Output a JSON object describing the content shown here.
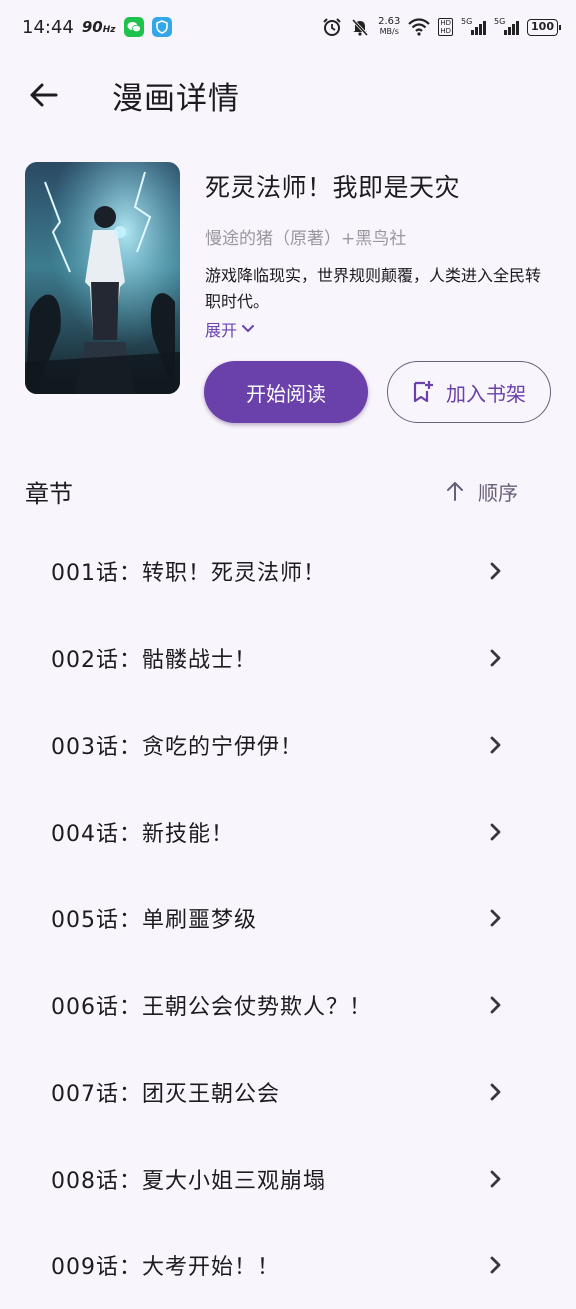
{
  "status_bar": {
    "time": "14:44",
    "refresh_rate": "90",
    "refresh_unit": "Hz",
    "net_speed_value": "2.63",
    "net_speed_unit": "MB/s",
    "sim1_label": "5G",
    "sim2_label": "5G",
    "hd_label": "HD",
    "battery": "100"
  },
  "app_bar": {
    "title": "漫画详情"
  },
  "comic": {
    "title": "死灵法师！我即是天灾",
    "author": "慢途的猪（原著）+黑鸟社",
    "summary": "游戏降临现实，世界规则颠覆，人类进入全民转职时代。",
    "expand_label": "展开"
  },
  "actions": {
    "start_reading": "开始阅读",
    "add_to_shelf": "加入书架"
  },
  "chapters_section": {
    "label": "章节",
    "order_label": "顺序"
  },
  "chapters": [
    {
      "title": "001话：转职！死灵法师！"
    },
    {
      "title": "002话：骷髅战士！"
    },
    {
      "title": "003话：贪吃的宁伊伊！"
    },
    {
      "title": "004话：新技能！"
    },
    {
      "title": "005话：单刷噩梦级"
    },
    {
      "title": "006话：王朝公会仗势欺人？！"
    },
    {
      "title": "007话：团灭王朝公会"
    },
    {
      "title": "008话：夏大小姐三观崩塌"
    },
    {
      "title": "009话：大考开始！！"
    }
  ],
  "colors": {
    "background": "#f9f5fc",
    "primary": "#6a40ab",
    "muted_text": "#9a96a0"
  }
}
